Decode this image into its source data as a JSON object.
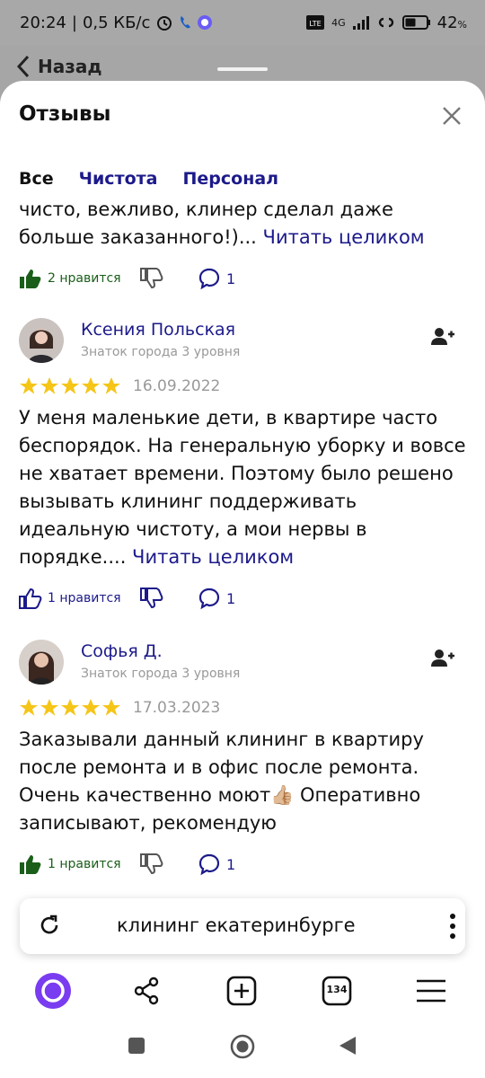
{
  "status_bar": {
    "time": "20:24",
    "speed": "0,5 КБ/с",
    "network": "4G",
    "battery": "42"
  },
  "back": {
    "label": "Назад"
  },
  "sheet": {
    "title": "Отзывы"
  },
  "tabs": [
    {
      "label": "Все",
      "active": true
    },
    {
      "label": "Чистота",
      "active": false
    },
    {
      "label": "Персонал",
      "active": false
    }
  ],
  "reviews": [
    {
      "text_line_1": "чисто, вежливо, клинер сделал даже",
      "text_line_2": "больше заказанного!)... ",
      "read_more": "Читать целиком",
      "likes": "2 нравится",
      "comments": "1"
    },
    {
      "author": "Ксения Польская",
      "level": "Знаток города 3 уровня",
      "rating": 5,
      "date": "16.09.2022",
      "text": "У меня маленькие дети, в квартире часто беспорядок. На генеральную уборку и вовсе не хватает времени. Поэтому было решено вызывать клининг поддерживать идеальную чистоту, а мои нервы в порядке.... ",
      "read_more": "Читать целиком",
      "likes": "1 нравится",
      "comments": "1"
    },
    {
      "author": "Софья Д.",
      "level": "Знаток города 3 уровня",
      "rating": 5,
      "date": "17.03.2023",
      "text_before_emoji": "Заказывали данный клининг в квартиру после ремонта и в офис после ремонта. Очень качественно моют",
      "emoji": "👍🏼",
      "text_after_emoji": " Оперативно записывают, рекомендую",
      "likes": "1 нравится",
      "comments": "1"
    }
  ],
  "search": {
    "query": "клининг екатеринбурге"
  },
  "bottom_nav": {
    "tabs_count": "134"
  },
  "colors": {
    "link": "#1c1a8a",
    "like_green": "#1a5e1a",
    "star": "#f5c518",
    "alice": "#7a3cf0"
  }
}
